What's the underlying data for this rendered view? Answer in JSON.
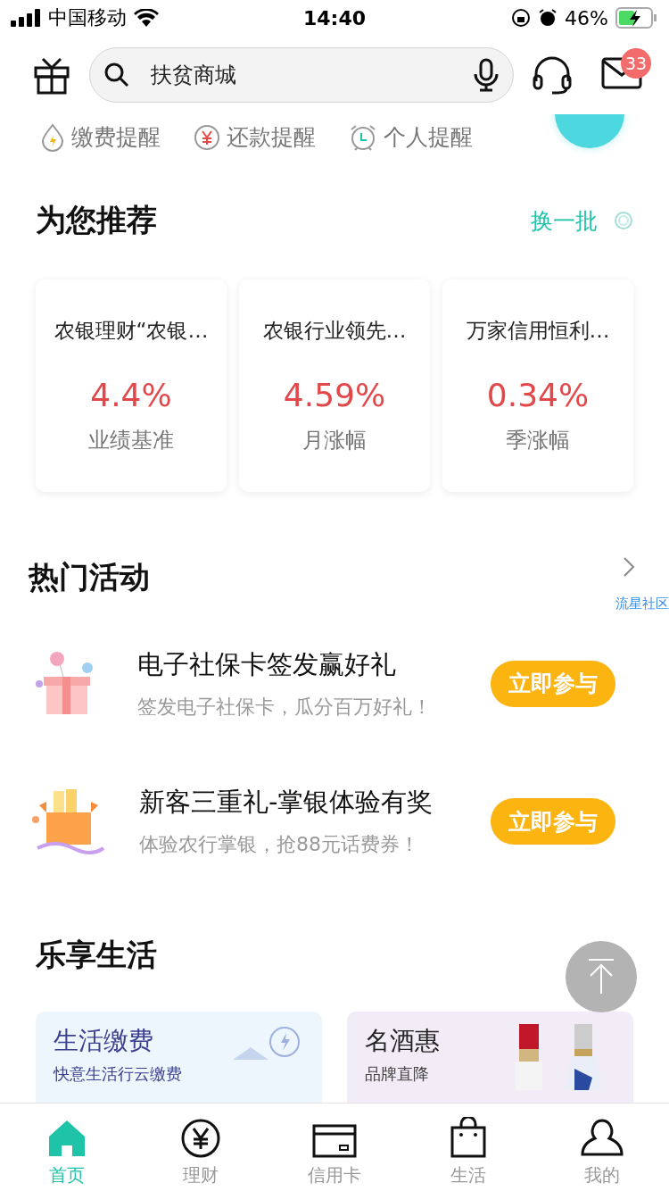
{
  "status_bar": {
    "carrier": "中国移动",
    "time": "14:40",
    "battery": "46%"
  },
  "header": {
    "search": {
      "value": "扶贫商城"
    },
    "mail_badge": "33"
  },
  "reminders": [
    {
      "kind": "bill",
      "label": "缴费提醒"
    },
    {
      "kind": "repay",
      "label": "还款提醒"
    },
    {
      "kind": "personal",
      "label": "个人提醒"
    }
  ],
  "recommend": {
    "title": "为您推荐",
    "refresh": "换一批",
    "products": [
      {
        "name": "农银理财“农银…",
        "rate": "4.4%",
        "rate_label": "业绩基准"
      },
      {
        "name": "农银行业领先…",
        "rate": "4.59%",
        "rate_label": "月涨幅"
      },
      {
        "name": "万家信用恒利…",
        "rate": "0.34%",
        "rate_label": "季涨幅"
      }
    ]
  },
  "hot": {
    "title": "热门活动",
    "community": "流星社区",
    "activities": [
      {
        "kind": "gift",
        "title": "电子社保卡签发赢好礼",
        "desc": "签发电子社保卡，瓜分百万好礼！",
        "button": "立即参与"
      },
      {
        "kind": "box",
        "title": "新客三重礼-掌银体验有奖",
        "desc": "体验农行掌银，抢88元话费券！",
        "button": "立即参与"
      }
    ]
  },
  "life": {
    "title": "乐享生活",
    "cards": [
      {
        "kind": "bill",
        "title": "生活缴费",
        "subtitle": "快意生活行云缴费"
      },
      {
        "kind": "wine",
        "title": "名酒惠",
        "subtitle": "品牌直降"
      }
    ]
  },
  "tabs": [
    {
      "kind": "home",
      "label": "首页",
      "selected": true
    },
    {
      "kind": "wealth",
      "label": "理财",
      "selected": false
    },
    {
      "kind": "card",
      "label": "信用卡",
      "selected": false
    },
    {
      "kind": "life",
      "label": "生活",
      "selected": false
    },
    {
      "kind": "me",
      "label": "我的",
      "selected": false
    }
  ]
}
